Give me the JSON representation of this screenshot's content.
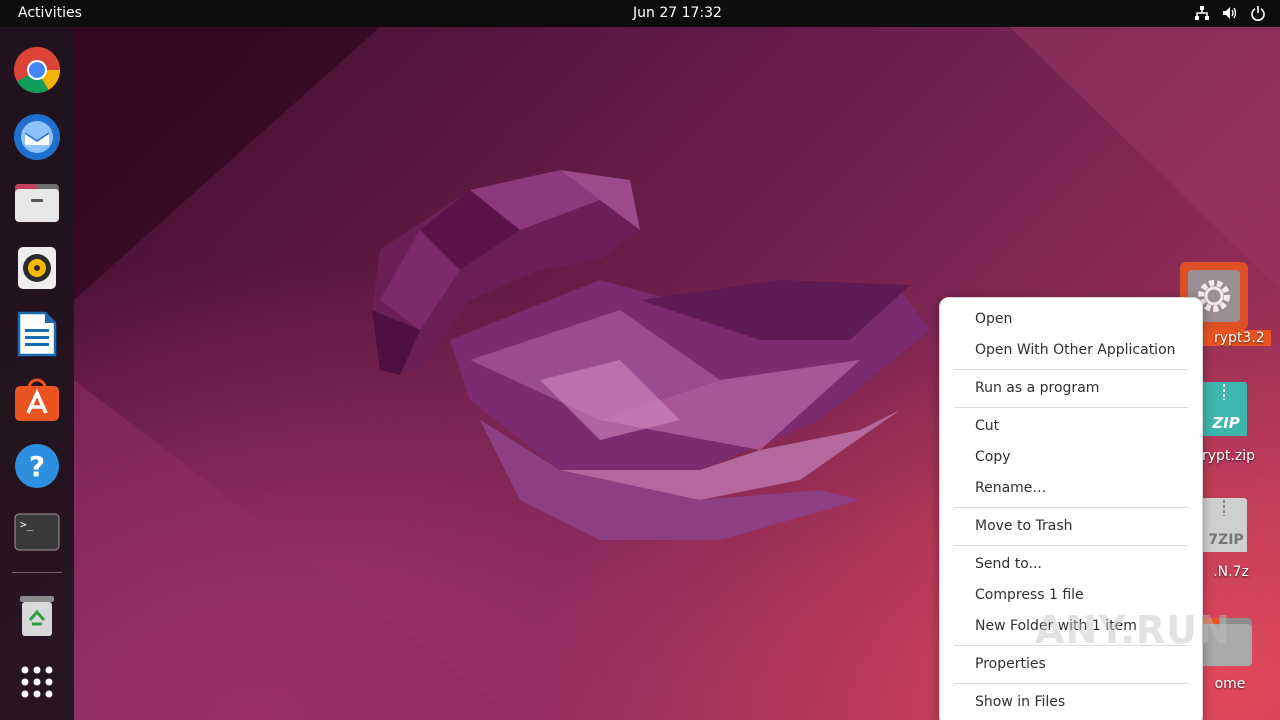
{
  "topbar": {
    "activities": "Activities",
    "clock": "Jun 27  17:32",
    "tray": [
      "network-icon",
      "volume-icon",
      "power-icon"
    ]
  },
  "dock": {
    "items": [
      {
        "icon": "chrome-icon"
      },
      {
        "icon": "thunderbird-icon"
      },
      {
        "icon": "files-icon"
      },
      {
        "icon": "rhythmbox-icon"
      },
      {
        "icon": "writer-icon"
      },
      {
        "icon": "app-center-icon"
      },
      {
        "icon": "help-icon"
      },
      {
        "icon": "terminal-icon"
      },
      {
        "icon": "trash-icon"
      },
      {
        "icon": "app-grid-icon"
      }
    ]
  },
  "desktop_icons": [
    {
      "label": "rypt3.2",
      "icon": "executable-gear-icon"
    },
    {
      "label": "rypt.zip",
      "icon": "zip-archive-icon"
    },
    {
      "label": ".N.7z",
      "icon": "7z-archive-icon"
    },
    {
      "label": "ome",
      "icon": "home-folder-icon"
    }
  ],
  "context_menu": {
    "groups": [
      [
        "Open",
        "Open With Other Application"
      ],
      [
        "Run as a program"
      ],
      [
        "Cut",
        "Copy",
        "Rename…"
      ],
      [
        "Move to Trash"
      ],
      [
        "Send to...",
        "Compress 1 file",
        "New Folder with 1 item"
      ],
      [
        "Properties"
      ],
      [
        "Show in Files"
      ]
    ]
  },
  "watermark": "ANY.RUN",
  "colors": {
    "topbar": "#0d0d0d",
    "dock": "#1e141c",
    "selection_accent": "#e95420",
    "menu_bg": "#ffffff"
  }
}
